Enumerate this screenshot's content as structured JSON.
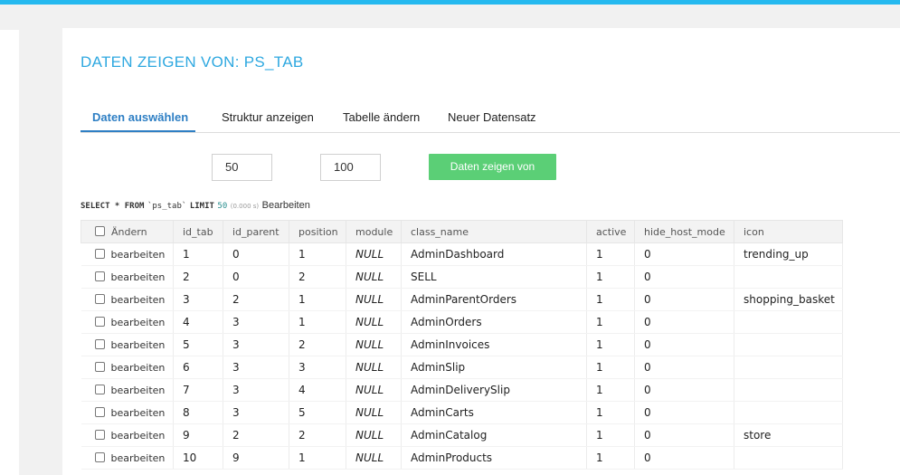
{
  "page": {
    "title": "DATEN ZEIGEN VON: PS_TAB"
  },
  "tabs": [
    {
      "label": "Daten auswählen",
      "active": true
    },
    {
      "label": "Struktur anzeigen"
    },
    {
      "label": "Tabelle ändern"
    },
    {
      "label": "Neuer Datensatz"
    }
  ],
  "controls": {
    "limit_value": "50",
    "second_value": "100",
    "submit_label": "Daten zeigen von"
  },
  "sql": {
    "select": "SELECT * FROM",
    "table": "`ps_tab`",
    "limit_kw": "LIMIT",
    "limit": "50",
    "time": "(0.000 s)",
    "edit_label": "Bearbeiten"
  },
  "table": {
    "header_edit": "Ändern",
    "columns": [
      "id_tab",
      "id_parent",
      "position",
      "module",
      "class_name",
      "active",
      "hide_host_mode",
      "icon"
    ],
    "edit_label": "bearbeiten",
    "rows": [
      [
        "1",
        "0",
        "1",
        "NULL",
        "AdminDashboard",
        "1",
        "0",
        "trending_up"
      ],
      [
        "2",
        "0",
        "2",
        "NULL",
        "SELL",
        "1",
        "0",
        ""
      ],
      [
        "3",
        "2",
        "1",
        "NULL",
        "AdminParentOrders",
        "1",
        "0",
        "shopping_basket"
      ],
      [
        "4",
        "3",
        "1",
        "NULL",
        "AdminOrders",
        "1",
        "0",
        ""
      ],
      [
        "5",
        "3",
        "2",
        "NULL",
        "AdminInvoices",
        "1",
        "0",
        ""
      ],
      [
        "6",
        "3",
        "3",
        "NULL",
        "AdminSlip",
        "1",
        "0",
        ""
      ],
      [
        "7",
        "3",
        "4",
        "NULL",
        "AdminDeliverySlip",
        "1",
        "0",
        ""
      ],
      [
        "8",
        "3",
        "5",
        "NULL",
        "AdminCarts",
        "1",
        "0",
        ""
      ],
      [
        "9",
        "2",
        "2",
        "NULL",
        "AdminCatalog",
        "1",
        "0",
        "store"
      ],
      [
        "10",
        "9",
        "1",
        "NULL",
        "AdminProducts",
        "1",
        "0",
        ""
      ]
    ]
  },
  "colors": {
    "accent": "#2ea8e0",
    "tab_active": "#2e7fc4",
    "button": "#5bcf76",
    "topbar": "#25b9ef"
  }
}
